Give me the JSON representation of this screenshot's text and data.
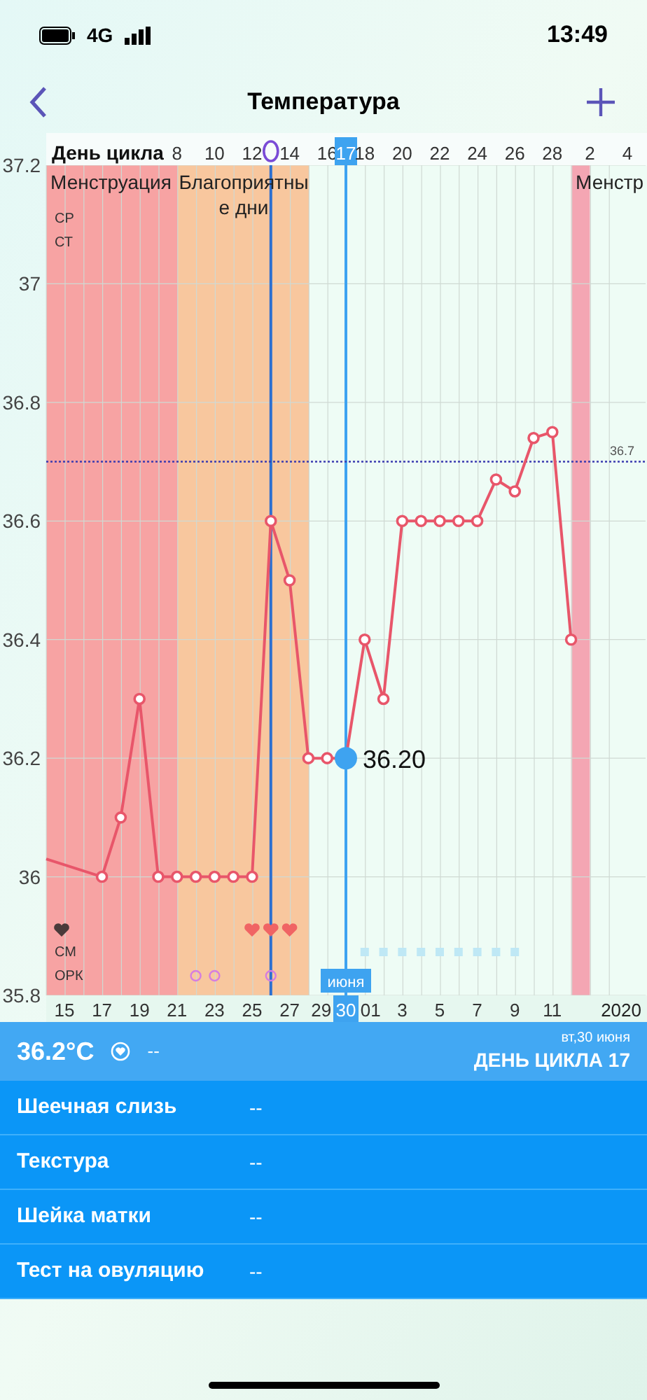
{
  "status_bar": {
    "network": "4G",
    "time": "13:49"
  },
  "header": {
    "title": "Температура"
  },
  "chart": {
    "axis_title": "День цикла",
    "top_labels": [
      {
        "text": "8",
        "selected": false
      },
      {
        "text": "10",
        "selected": false
      },
      {
        "text": "12",
        "selected": false
      },
      {
        "text": "14",
        "selected": false
      },
      {
        "text": "16",
        "selected": false
      },
      {
        "text": "17",
        "selected": true
      },
      {
        "text": "18",
        "selected": false
      },
      {
        "text": "20",
        "selected": false
      },
      {
        "text": "22",
        "selected": false
      },
      {
        "text": "24",
        "selected": false
      },
      {
        "text": "26",
        "selected": false
      },
      {
        "text": "28",
        "selected": false
      },
      {
        "text": "2",
        "selected": false
      },
      {
        "text": "4",
        "selected": false
      }
    ],
    "month_label": "июня",
    "year_label": "2020",
    "bands": [
      {
        "kind": "menstruation",
        "lines": [
          "Менструация"
        ]
      },
      {
        "kind": "fertile",
        "lines": [
          "Благоприятны",
          "е дни"
        ]
      },
      {
        "kind": "menstruation_next",
        "lines": [
          "Менстр"
        ]
      }
    ],
    "side_labels": [
      "СР",
      "СТ",
      "СМ",
      "ОРК"
    ],
    "selected_reading": "36.20",
    "chart_data": {
      "type": "line",
      "grid": true,
      "ylim": [
        35.8,
        37.2
      ],
      "yticks": [
        35.8,
        36,
        36.2,
        36.4,
        36.6,
        36.8,
        37,
        37.2
      ],
      "categories": [
        "15",
        null,
        "17",
        null,
        "19",
        null,
        "21",
        null,
        "23",
        null,
        "25",
        null,
        "27",
        null,
        "29",
        "30",
        "01",
        null,
        "3",
        null,
        "5",
        null,
        "7",
        null,
        "9",
        null,
        "11",
        null
      ],
      "series": [
        {
          "color": "#e8566a",
          "marker": "o",
          "values": [
            null,
            null,
            36.0,
            36.1,
            36.3,
            36.0,
            36.0,
            36.0,
            36.0,
            36.0,
            36.0,
            36.6,
            36.5,
            36.2,
            36.2,
            36.2,
            36.4,
            36.3,
            36.6,
            36.6,
            36.6,
            36.6,
            36.6,
            36.67,
            36.65,
            36.74,
            36.75,
            36.4
          ]
        }
      ],
      "ref_lines": [
        {
          "axis": "y",
          "value": 36.7,
          "color": "#3b3bb0",
          "label": "36.7"
        }
      ]
    }
  },
  "summary": {
    "temperature": "36.2°C",
    "note": "--",
    "date": "вт,30 июня",
    "cycle_day": "ДЕНЬ ЦИКЛА 17"
  },
  "rows": [
    {
      "label": "Шеечная слизь",
      "value": "--"
    },
    {
      "label": "Текстура",
      "value": "--"
    },
    {
      "label": "Шейка матки",
      "value": "--"
    },
    {
      "label": "Тест на овуляцию",
      "value": "--"
    }
  ]
}
